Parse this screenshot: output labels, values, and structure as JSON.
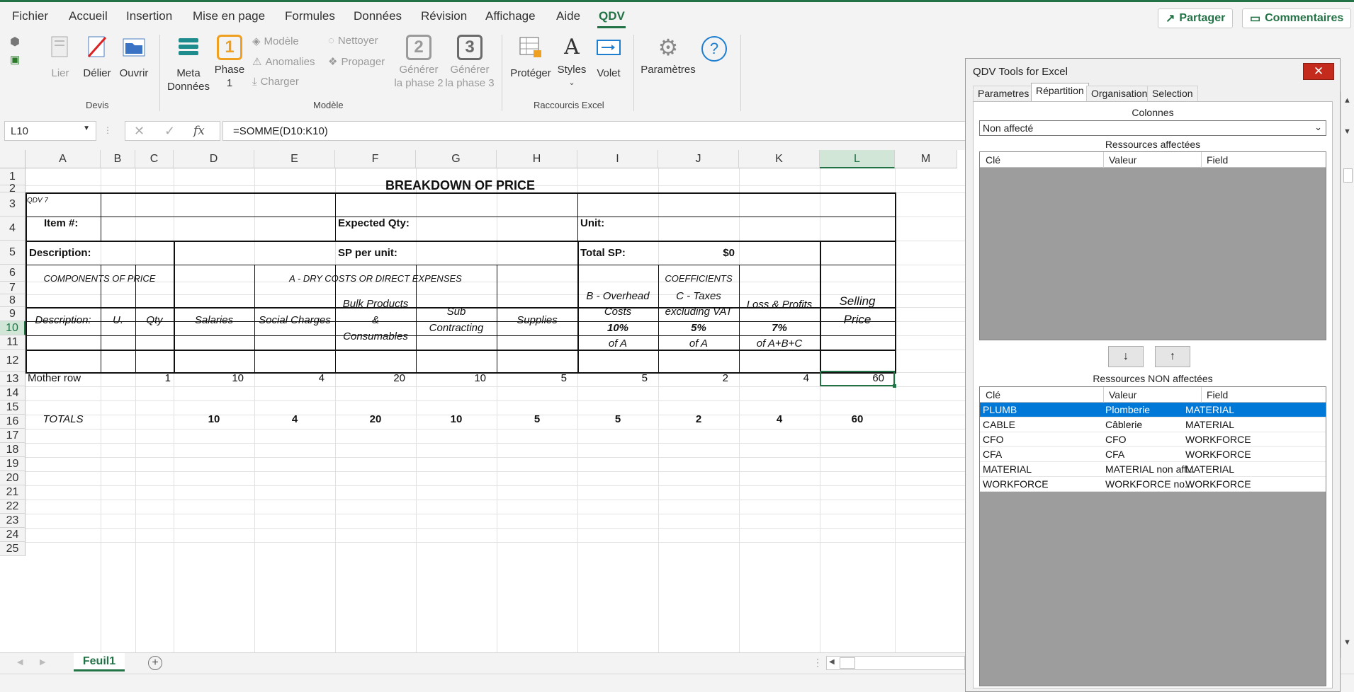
{
  "ribbon_tabs": [
    {
      "label": "Fichier"
    },
    {
      "label": "Accueil"
    },
    {
      "label": "Insertion"
    },
    {
      "label": "Mise en page"
    },
    {
      "label": "Formules"
    },
    {
      "label": "Données"
    },
    {
      "label": "Révision"
    },
    {
      "label": "Affichage"
    },
    {
      "label": "Aide"
    },
    {
      "label": "QDV"
    }
  ],
  "share_label": "Partager",
  "comments_label": "Commentaires",
  "ribbon": {
    "lier": "Lier",
    "delier": "Délier",
    "ouvrir": "Ouvrir",
    "devis": "Devis",
    "meta_line1": "Meta",
    "meta_line2": "Données",
    "phase1_line1": "Phase",
    "phase1_line2": "1",
    "phase1_num": "1",
    "modele": "Modèle",
    "anomalies": "Anomalies",
    "charger": "Charger",
    "nettoyer": "Nettoyer",
    "propager": "Propager",
    "gen2_line1": "Générer",
    "gen2_line2": "la phase 2",
    "gen2_num": "2",
    "gen3_line1": "Générer",
    "gen3_line2": "la phase 3",
    "gen3_num": "3",
    "modele_group": "Modèle",
    "proteger": "Protéger",
    "styles": "Styles",
    "volet": "Volet",
    "raccourcis_group": "Raccourcis Excel",
    "parametres": "Paramètres",
    "help_icon": "?"
  },
  "formula_bar": {
    "name_box": "L10",
    "fx": "fx",
    "formula": "=SOMME(D10:K10)"
  },
  "columns": [
    "A",
    "B",
    "C",
    "D",
    "E",
    "F",
    "G",
    "H",
    "I",
    "J",
    "K",
    "L",
    "M"
  ],
  "rows": [
    "1",
    "2",
    "3",
    "4",
    "5",
    "6",
    "7",
    "8",
    "9",
    "10",
    "11",
    "12",
    "13",
    "14",
    "15",
    "16",
    "17",
    "18",
    "19",
    "20",
    "21",
    "22",
    "23",
    "24",
    "25"
  ],
  "sheet": {
    "title": "BREAKDOWN OF PRICE",
    "qdv": "QDV 7",
    "item": "Item #:",
    "expected_qty": "Expected Qty:",
    "unit": "Unit:",
    "description_lbl": "Description:",
    "sp_per_unit": "SP per unit:",
    "total_sp": "Total SP:",
    "total_sp_val": "$0",
    "components": "COMPONENTS OF PRICE",
    "dry_costs": "A - DRY COSTS OR DIRECT EXPENSES",
    "coefficients": "COEFFICIENTS",
    "h_description": "Description:",
    "h_u": "U.",
    "h_qty": "Qty",
    "h_salaries": "Salaries",
    "h_social": "Social Charges",
    "h_bulk1": "Bulk Products",
    "h_bulk2": "&",
    "h_bulk3": "Consumables",
    "h_sub1": "Sub",
    "h_sub2": "Contracting",
    "h_supplies": "Supplies",
    "h_b1": "B - Overhead",
    "h_b2": "Costs",
    "h_b3": "10%",
    "h_b4": "of A",
    "h_c1": "C - Taxes",
    "h_c2": "excluding VAT",
    "h_c3": "5%",
    "h_c4": "of A",
    "h_k1": "Loss & Profits",
    "h_k3": "7%",
    "h_k4": "of A+B+C",
    "h_sp1": "Selling",
    "h_sp2": "Price",
    "row10": {
      "a": "Mother row",
      "c": "1",
      "d": "10",
      "e": "4",
      "f": "20",
      "g": "10",
      "h": "5",
      "i": "5",
      "j": "2",
      "k": "4",
      "l": "60"
    },
    "totals": {
      "a": "TOTALS",
      "d": "10",
      "e": "4",
      "f": "20",
      "g": "10",
      "h": "5",
      "i": "5",
      "j": "2",
      "k": "4",
      "l": "60"
    }
  },
  "sheet_tab": "Feuil1",
  "panel": {
    "title": "QDV Tools for Excel",
    "close": "✕",
    "tabs": [
      "Parametres",
      "Répartition",
      "Organisation",
      "Selection"
    ],
    "colonnes": "Colonnes",
    "select_value": "Non affecté",
    "affected_label": "Ressources affectées",
    "col_headers": [
      "Clé",
      "Valeur",
      "Field"
    ],
    "down": "↓",
    "up": "↑",
    "non_affected_label": "Ressources NON affectées",
    "rows": [
      {
        "key": "PLUMB",
        "value": "Plomberie",
        "field": "MATERIAL"
      },
      {
        "key": "CABLE",
        "value": "Câblerie",
        "field": "MATERIAL"
      },
      {
        "key": "CFO",
        "value": "CFO",
        "field": "WORKFORCE"
      },
      {
        "key": "CFA",
        "value": "CFA",
        "field": "WORKFORCE"
      },
      {
        "key": "MATERIAL",
        "value": "MATERIAL non aff...",
        "field": "MATERIAL"
      },
      {
        "key": "WORKFORCE",
        "value": "WORKFORCE no...",
        "field": "WORKFORCE"
      }
    ]
  }
}
